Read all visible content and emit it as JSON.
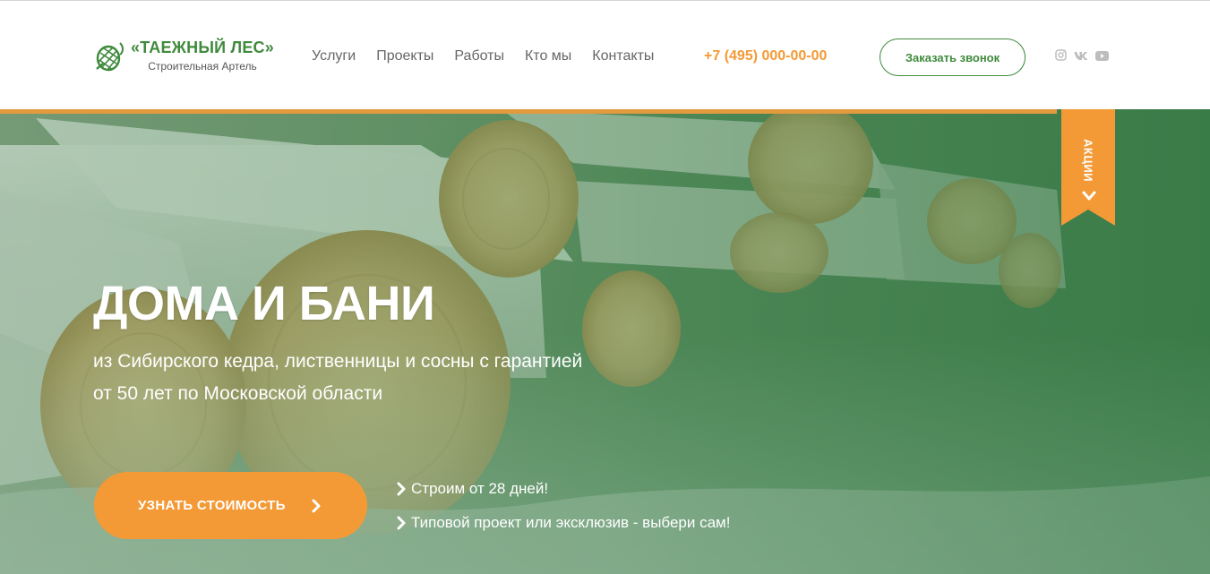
{
  "brand": {
    "title": "«ТАЕЖНЫЙ ЛЕС»",
    "subtitle": "Строительная Артель",
    "color": "#3f8a3c"
  },
  "nav": {
    "items": [
      {
        "label": "Услуги"
      },
      {
        "label": "Проекты"
      },
      {
        "label": "Работы"
      },
      {
        "label": "Кто мы"
      },
      {
        "label": "Контакты"
      }
    ]
  },
  "contact": {
    "phone": "+7 (495) 000-00-00",
    "callback_label": "Заказать звонок"
  },
  "social": {
    "icons": [
      "instagram-icon",
      "vk-icon",
      "youtube-icon"
    ]
  },
  "promo": {
    "label": "АКЦИИ",
    "color": "#f39a36"
  },
  "hero": {
    "title": "ДОМА И БАНИ",
    "subtitle_line1": "из Сибирского кедра, лиственницы и сосны с гарантией",
    "subtitle_line2": "от 50 лет по Московской области",
    "cta_label": "УЗНАТЬ СТОИМОСТЬ",
    "features": [
      {
        "text": "Строим от 28 дней!"
      },
      {
        "text": "Типовой проект или эксклюзив - выбери сам!"
      }
    ]
  },
  "colors": {
    "accent": "#f39a36",
    "green": "#3f8a3c",
    "nav_text": "#666666"
  }
}
